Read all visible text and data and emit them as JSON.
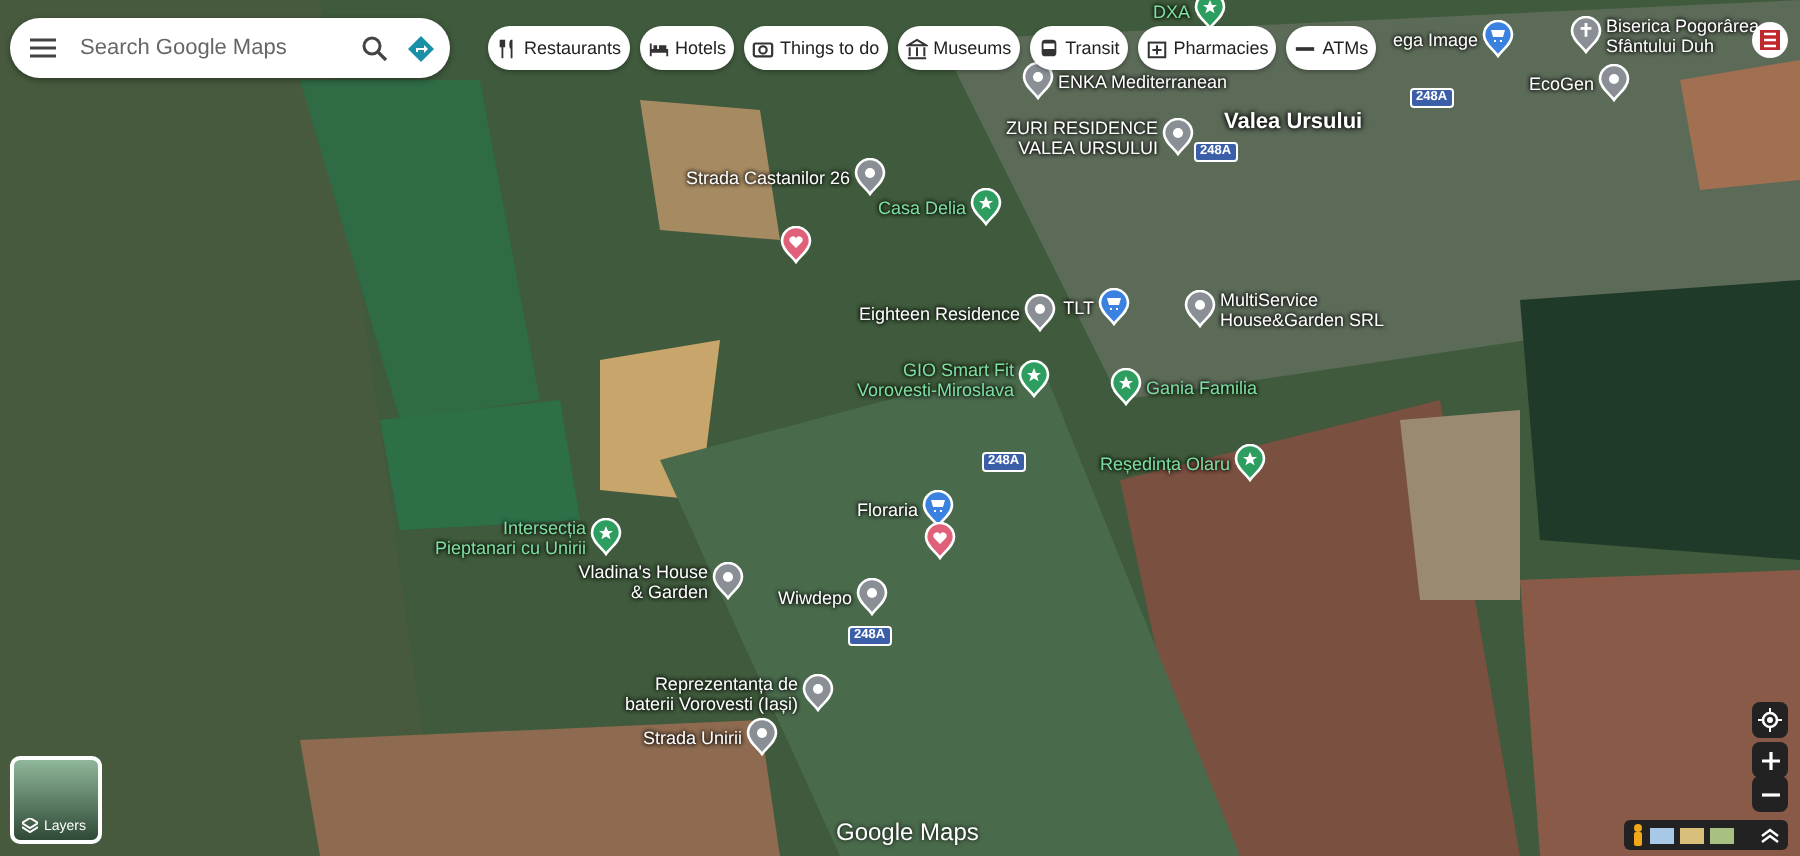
{
  "search": {
    "placeholder": "Search Google Maps"
  },
  "chips": [
    {
      "label": "Restaurants",
      "kind": "restaurant"
    },
    {
      "label": "Hotels",
      "kind": "hotel"
    },
    {
      "label": "Things to do",
      "kind": "camera"
    },
    {
      "label": "Museums",
      "kind": "museum"
    },
    {
      "label": "Transit",
      "kind": "transit"
    },
    {
      "label": "Pharmacies",
      "kind": "pharmacy"
    },
    {
      "label": "ATMs",
      "kind": "atm"
    }
  ],
  "places": [
    {
      "lines": [
        "DXA"
      ],
      "kind": "green"
    },
    {
      "lines": [
        "ENKA Mediterranean"
      ],
      "kind": "place"
    },
    {
      "lines": [
        "ZURI RESIDENCE",
        "VALEA URSULUI"
      ],
      "kind": "place"
    },
    {
      "lines": [
        "ega Image"
      ],
      "kind": "shop"
    },
    {
      "lines": [
        "Biserica Pogorârea",
        "Sfântului Duh"
      ],
      "kind": "church"
    },
    {
      "lines": [
        "EcoGen"
      ],
      "kind": "place"
    },
    {
      "lines": [
        "Strada Castanilor 26"
      ],
      "kind": "place"
    },
    {
      "lines": [
        "Casa Delia"
      ],
      "kind": "green"
    },
    {
      "kind": "heart"
    },
    {
      "lines": [
        "Eighteen Residence"
      ],
      "kind": "place"
    },
    {
      "lines": [
        "TLT"
      ],
      "kind": "shop"
    },
    {
      "lines": [
        "MultiService",
        "House&Garden SRL"
      ],
      "kind": "place"
    },
    {
      "lines": [
        "GIO Smart Fit",
        "Vorovesti-Miroslava"
      ],
      "kind": "green"
    },
    {
      "lines": [
        "Gania Familia"
      ],
      "kind": "green"
    },
    {
      "lines": [
        "Reședința Olaru"
      ],
      "kind": "green"
    },
    {
      "lines": [
        "Floraria"
      ],
      "kind": "shop"
    },
    {
      "kind": "heart"
    },
    {
      "lines": [
        "Intersecția",
        "Pieptanari cu Unirii"
      ],
      "kind": "green"
    },
    {
      "lines": [
        "Vladina's House",
        "& Garden"
      ],
      "kind": "place"
    },
    {
      "lines": [
        "Wiwdepo"
      ],
      "kind": "place"
    },
    {
      "lines": [
        "Reprezentanța de",
        "baterii Vorovesti (Iași)"
      ],
      "kind": "place"
    },
    {
      "lines": [
        "Strada Unirii"
      ],
      "kind": "place"
    }
  ],
  "town": "Valea Ursului",
  "road_shields": [
    "248A",
    "248A",
    "248A",
    "248A"
  ],
  "layers": {
    "label": "Layers"
  },
  "logo": "Google Maps"
}
